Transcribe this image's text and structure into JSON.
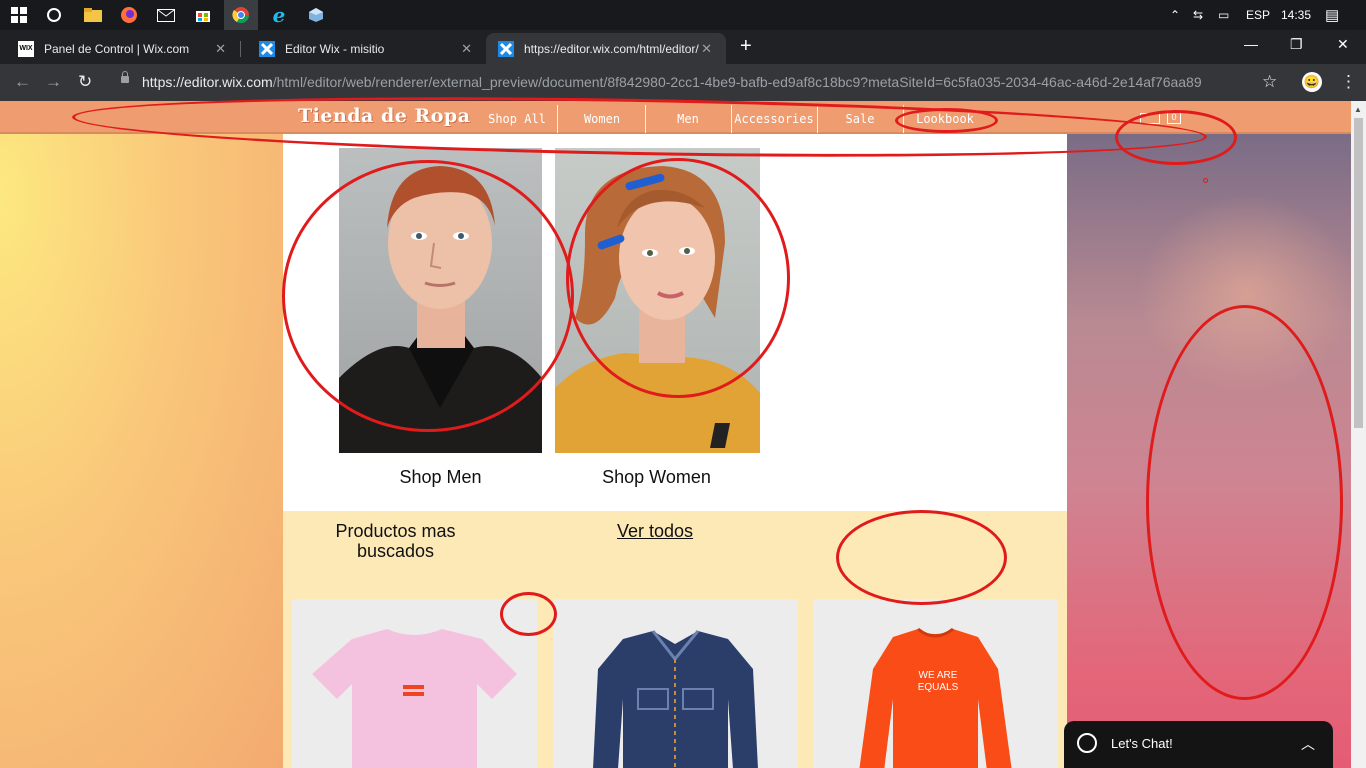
{
  "taskbar": {
    "tray": {
      "lang": "ESP",
      "time": "14:35"
    }
  },
  "browser": {
    "tabs": [
      {
        "label": "Panel de Control | Wix.com",
        "favicon": "WIX"
      },
      {
        "label": "Editor Wix - misitio",
        "favicon": "wix-editor-icon"
      },
      {
        "label": "https://editor.wix.com/html/editor/web/renderer",
        "favicon": "wix-editor-icon"
      }
    ],
    "url_host": "https://editor.wix.com",
    "url_path": "/html/editor/web/renderer/external_preview/document/8f842980-2cc1-4be9-bafb-ed9af8c18bc9?metaSiteId=6c5fa035-2034-46ac-a46d-2e14af76aa89"
  },
  "site": {
    "logo": "Tienda de Ropa",
    "menu": [
      "Shop All",
      "Women",
      "Men",
      "Accessories",
      "Sale",
      "Lookbook"
    ],
    "shop_men": "Shop Men",
    "shop_women": "Shop Women",
    "featured_title": "Productos mas buscados",
    "featured_link": "Ver todos",
    "product3_print": "WE ARE EQUALS"
  },
  "chat": {
    "label": "Let's Chat!"
  },
  "colors": {
    "header": "#ee9c70",
    "annotation": "#e01b1b",
    "featured_bg": "#fde9b6"
  }
}
